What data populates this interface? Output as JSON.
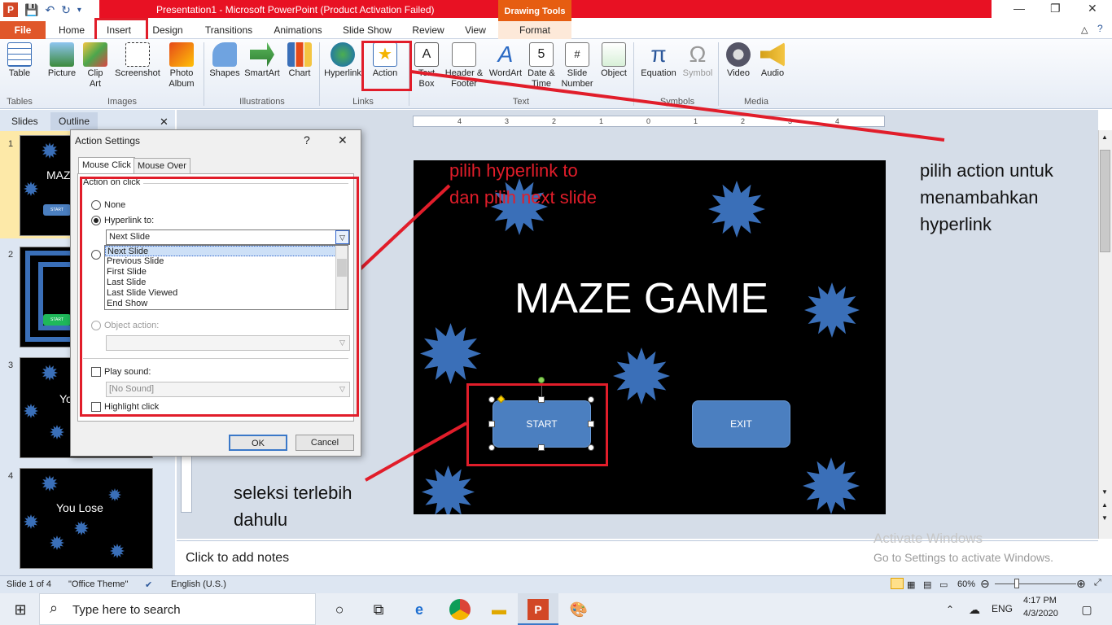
{
  "window": {
    "title": "Presentation1  -  Microsoft PowerPoint (Product Activation Failed)",
    "contextual_tab_group": "Drawing Tools"
  },
  "tabs": [
    {
      "label": "File"
    },
    {
      "label": "Home"
    },
    {
      "label": "Insert"
    },
    {
      "label": "Design"
    },
    {
      "label": "Transitions"
    },
    {
      "label": "Animations"
    },
    {
      "label": "Slide Show"
    },
    {
      "label": "Review"
    },
    {
      "label": "View"
    },
    {
      "label": "Format"
    }
  ],
  "ribbon": {
    "buttons": [
      {
        "label": "Table",
        "icon": "table-icon"
      },
      {
        "label": "Picture",
        "icon": "picture-icon"
      },
      {
        "label": "Clip Art",
        "icon": "clip-art-icon"
      },
      {
        "label": "Screenshot",
        "icon": "screenshot-icon"
      },
      {
        "label": "Photo Album",
        "icon": "photo-album-icon"
      },
      {
        "label": "Shapes",
        "icon": "shapes-icon"
      },
      {
        "label": "SmartArt",
        "icon": "smartart-icon"
      },
      {
        "label": "Chart",
        "icon": "chart-icon"
      },
      {
        "label": "Hyperlink",
        "icon": "hyperlink-icon"
      },
      {
        "label": "Action",
        "icon": "action-icon"
      },
      {
        "label": "Text Box",
        "icon": "textbox-icon"
      },
      {
        "label": "Header & Footer",
        "icon": "header-footer-icon"
      },
      {
        "label": "WordArt",
        "icon": "wordart-icon"
      },
      {
        "label": "Date & Time",
        "icon": "date-time-icon"
      },
      {
        "label": "Slide Number",
        "icon": "slide-number-icon"
      },
      {
        "label": "Object",
        "icon": "object-icon"
      },
      {
        "label": "Equation",
        "icon": "equation-icon"
      },
      {
        "label": "Symbol",
        "icon": "symbol-icon"
      },
      {
        "label": "Video",
        "icon": "video-icon"
      },
      {
        "label": "Audio",
        "icon": "audio-icon"
      }
    ],
    "groups": [
      "Tables",
      "Images",
      "Illustrations",
      "Links",
      "Text",
      "Symbols",
      "Media"
    ]
  },
  "slide_panel": {
    "tabs": [
      "Slides",
      "Outline"
    ],
    "thumbnails": [
      {
        "num": "1",
        "text": "MAZ",
        "btn": "START"
      },
      {
        "num": "2",
        "btn": "START"
      },
      {
        "num": "3",
        "text": "Yo"
      },
      {
        "num": "4",
        "text": "You Lose"
      }
    ]
  },
  "slide": {
    "title": "MAZE GAME",
    "start_button": "START",
    "exit_button": "EXIT"
  },
  "ruler_marks": [
    "4",
    "3",
    "2",
    "1",
    "0",
    "1",
    "2",
    "3",
    "4"
  ],
  "dialog": {
    "title": "Action Settings",
    "help": "?",
    "close": "✕",
    "tabs": [
      "Mouse Click",
      "Mouse Over"
    ],
    "group_label": "Action on click",
    "none_label": "None",
    "hyperlink_label": "Hyperlink to:",
    "hyperlink_value": "Next Slide",
    "dropdown_options": [
      "Next Slide",
      "Previous Slide",
      "First Slide",
      "Last Slide",
      "Last Slide Viewed",
      "End Show"
    ],
    "object_action_label": "Object action:",
    "play_sound_label": "Play sound:",
    "sound_value": "[No Sound]",
    "highlight_label": "Highlight click",
    "ok": "OK",
    "cancel": "Cancel"
  },
  "annotations": {
    "top_red": [
      "pilih hyperlink to",
      "dan pilih next slide"
    ],
    "right": [
      "pilih action untuk",
      "menambahkan",
      "hyperlink"
    ],
    "bottom": [
      "seleksi terlebih",
      "dahulu"
    ]
  },
  "notes": {
    "placeholder": "Click to add notes"
  },
  "watermark": {
    "line1": "Activate Windows",
    "line2": "Go to Settings to activate Windows."
  },
  "statusbar": {
    "slide": "Slide 1 of 4",
    "theme": "\"Office Theme\"",
    "language": "English (U.S.)",
    "zoom": "60%"
  },
  "taskbar": {
    "search_placeholder": "Type here to search",
    "lang": "ENG",
    "time": "4:17 PM",
    "date": "4/3/2020"
  },
  "colors": {
    "accent_red": "#e11d2a",
    "slide_button": "#4b7fc0",
    "star": "#3a6fb8"
  }
}
